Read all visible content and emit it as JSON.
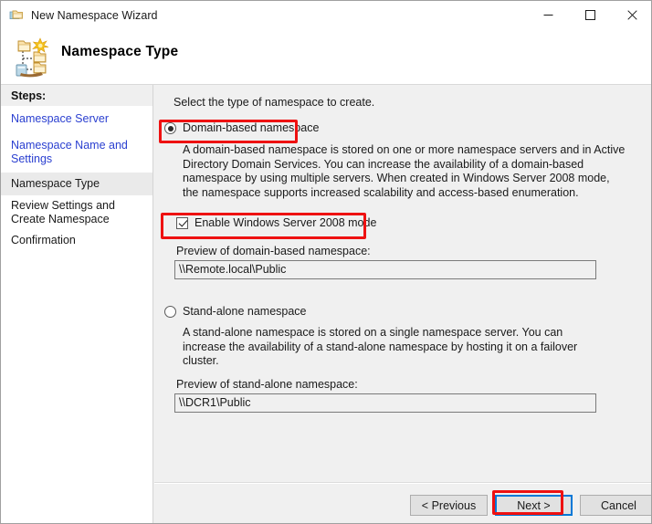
{
  "window": {
    "title": "New Namespace Wizard",
    "icon": "namespace-folder-icon",
    "controls": {
      "minimize": "minimize-icon",
      "maximize": "maximize-icon",
      "close": "close-icon"
    }
  },
  "header": {
    "title": "Namespace Type",
    "icon": "dfs-namespace-icon"
  },
  "sidebar": {
    "heading": "Steps:",
    "items": [
      {
        "label": "Namespace Server",
        "state": "link"
      },
      {
        "label": "Namespace Name and Settings",
        "state": "link"
      },
      {
        "label": "Namespace Type",
        "state": "current"
      },
      {
        "label": "Review Settings and Create Namespace",
        "state": "plain"
      },
      {
        "label": "Confirmation",
        "state": "plain"
      }
    ]
  },
  "main": {
    "intro": "Select the type of namespace to create.",
    "domain_option": {
      "label": "Domain-based namespace",
      "selected": true,
      "description": "A domain-based namespace is stored on one or more namespace servers and in Active Directory Domain Services. You can increase the availability of a domain-based namespace by using multiple servers. When created in Windows Server 2008 mode, the namespace supports increased scalability and access-based enumeration.",
      "checkbox_label": "Enable Windows Server 2008 mode",
      "checkbox_checked": true,
      "preview_label": "Preview of domain-based namespace:",
      "preview_value": "\\\\Remote.local\\Public"
    },
    "standalone_option": {
      "label": "Stand-alone namespace",
      "selected": false,
      "description": "A stand-alone namespace is stored on a single namespace server. You can increase the availability of a stand-alone namespace by hosting it on a failover cluster.",
      "preview_label": "Preview of stand-alone namespace:",
      "preview_value": "\\\\DCR1\\Public"
    }
  },
  "footer": {
    "previous": "< Previous",
    "next": "Next >",
    "cancel": "Cancel"
  },
  "annotations": {
    "accent_color": "#ee1111",
    "focus_color": "#0078d7",
    "link_color": "#2a3fd0"
  }
}
